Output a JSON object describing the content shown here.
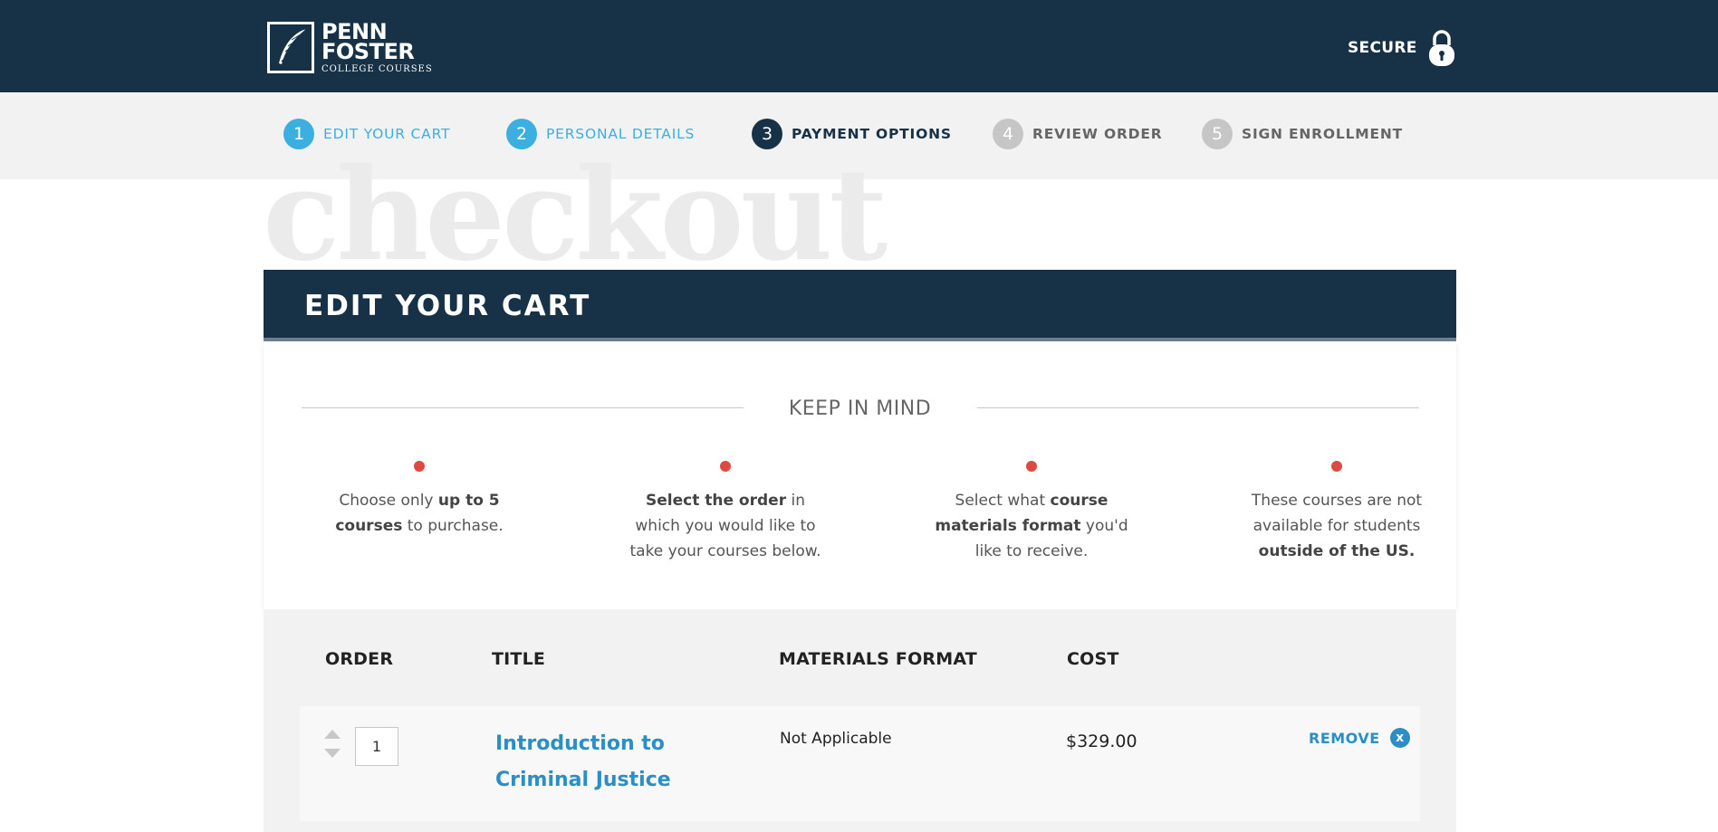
{
  "header": {
    "logo": {
      "line1": "PENN",
      "line2": "FOSTER",
      "line3": "COLLEGE COURSES"
    },
    "secure_label": "SECURE"
  },
  "steps": [
    {
      "num": "1",
      "label": "EDIT YOUR CART",
      "state": "done"
    },
    {
      "num": "2",
      "label": "PERSONAL DETAILS",
      "state": "done"
    },
    {
      "num": "3",
      "label": "PAYMENT OPTIONS",
      "state": "active"
    },
    {
      "num": "4",
      "label": "REVIEW ORDER",
      "state": "todo"
    },
    {
      "num": "5",
      "label": "SIGN ENROLLMENT",
      "state": "todo"
    }
  ],
  "watermark": "checkout",
  "cart": {
    "title": "EDIT YOUR CART",
    "keep_in_mind": "KEEP IN MIND",
    "tips": [
      {
        "pre": "Choose only ",
        "bold": "up to 5 courses",
        "post": " to purchase."
      },
      {
        "pre": "",
        "bold": "Select the order",
        "post": " in which you would like to take your courses below."
      },
      {
        "pre": "Select what ",
        "bold": "course materials format",
        "post": " you'd like to receive."
      },
      {
        "pre": "These courses are not available for students ",
        "bold": "outside of the US.",
        "post": ""
      }
    ]
  },
  "table": {
    "headers": {
      "order": "ORDER",
      "title": "TITLE",
      "format": "MATERIALS FORMAT",
      "cost": "COST"
    },
    "rows": [
      {
        "order": "1",
        "title": "Introduction to Criminal Justice",
        "format": "Not Applicable",
        "cost": "$329.00",
        "remove_label": "REMOVE",
        "remove_icon": "x"
      }
    ]
  },
  "colors": {
    "navy": "#173247",
    "accent_blue": "#3aafe0",
    "link_blue": "#2a8fc7",
    "bullet_red": "#dc4a42"
  }
}
